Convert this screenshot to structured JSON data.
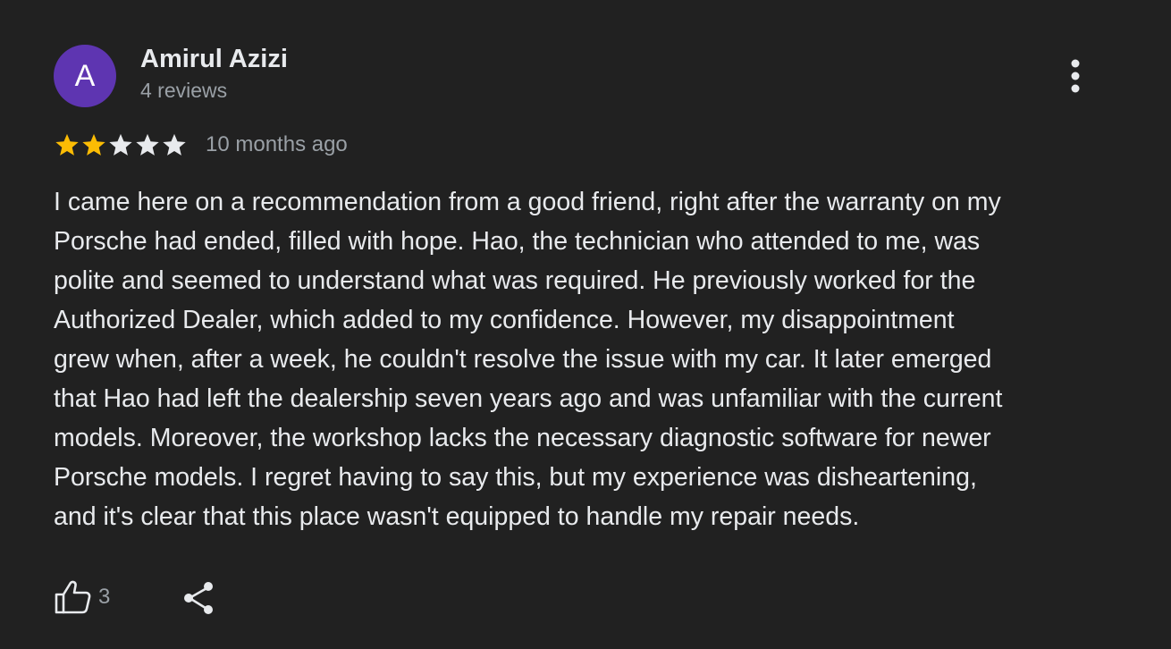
{
  "author": {
    "initial": "A",
    "name": "Amirul Azizi",
    "reviews": "4 reviews",
    "avatar_color": "#5e35b1"
  },
  "rating": {
    "stars": 2,
    "max": 5,
    "filled_color": "#fbbc04",
    "empty_color": "#e8eaed"
  },
  "time_ago": "10 months ago",
  "review_text": "I came here on a recommendation from a good friend, right after the warranty on my\nPorsche had ended, filled with hope. Hao, the technician who attended to me, was\npolite and seemed to understand what was required. He previously worked for the\nAuthorized Dealer, which added to my confidence. However, my disappointment\ngrew when, after a week, he couldn't resolve the issue with my car. It later emerged\nthat Hao had left the dealership seven years ago and was unfamiliar with the current\nmodels. Moreover, the workshop lacks the necessary diagnostic software for newer\nPorsche models. I regret having to say this, but my experience was disheartening,\nand it's clear that this place wasn't equipped to handle my repair needs.",
  "actions": {
    "like_count": "3",
    "like_icon": "thumbs-up-icon",
    "share_icon": "share-icon",
    "more_icon": "more-vert-icon"
  }
}
